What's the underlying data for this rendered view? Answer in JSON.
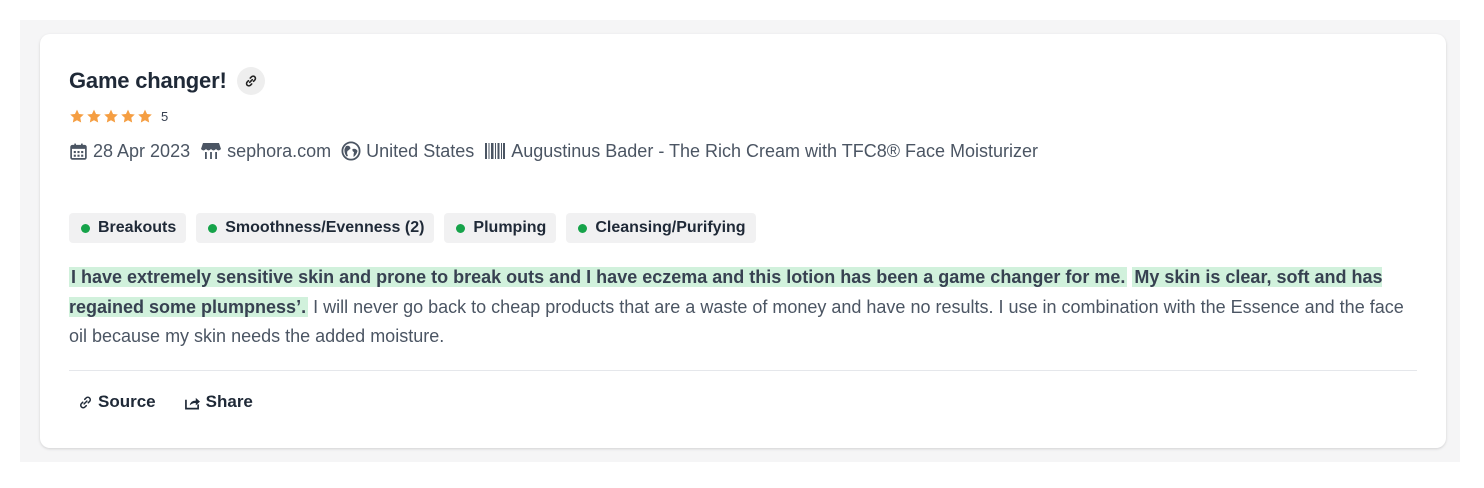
{
  "review": {
    "title": "Game changer!",
    "rating": 5,
    "rating_label": "5",
    "max_rating": 5,
    "star_color": "#f59e42",
    "date": "28 Apr 2023",
    "source": "sephora.com",
    "country": "United States",
    "product": "Augustinus Bader - The Rich Cream with TFC8® Face Moisturizer",
    "tags": [
      {
        "label": "Breakouts"
      },
      {
        "label": "Smoothness/Evenness (2)"
      },
      {
        "label": "Plumping"
      },
      {
        "label": "Cleansing/Purifying"
      }
    ],
    "tag_dot_color": "#16a34a",
    "highlight_color": "#d1f1dc",
    "text": {
      "highlight_1": "I have extremely sensitive skin and prone to break outs and I have eczema and this lotion has been a game changer for me.",
      "highlight_2": "My skin is clear, soft and has regained some plumpness’.",
      "rest": "I will never go back to cheap products that are a waste of money and have no results. I use in combination with the Essence and the face oil because my skin needs the added moisture."
    }
  },
  "actions": {
    "source_label": "Source",
    "share_label": "Share"
  },
  "icons": {
    "title_link": "link-icon",
    "date": "calendar-icon",
    "source": "shop-icon",
    "country": "globe-icon",
    "product": "barcode-icon",
    "source_action": "link-icon",
    "share_action": "share-icon"
  }
}
